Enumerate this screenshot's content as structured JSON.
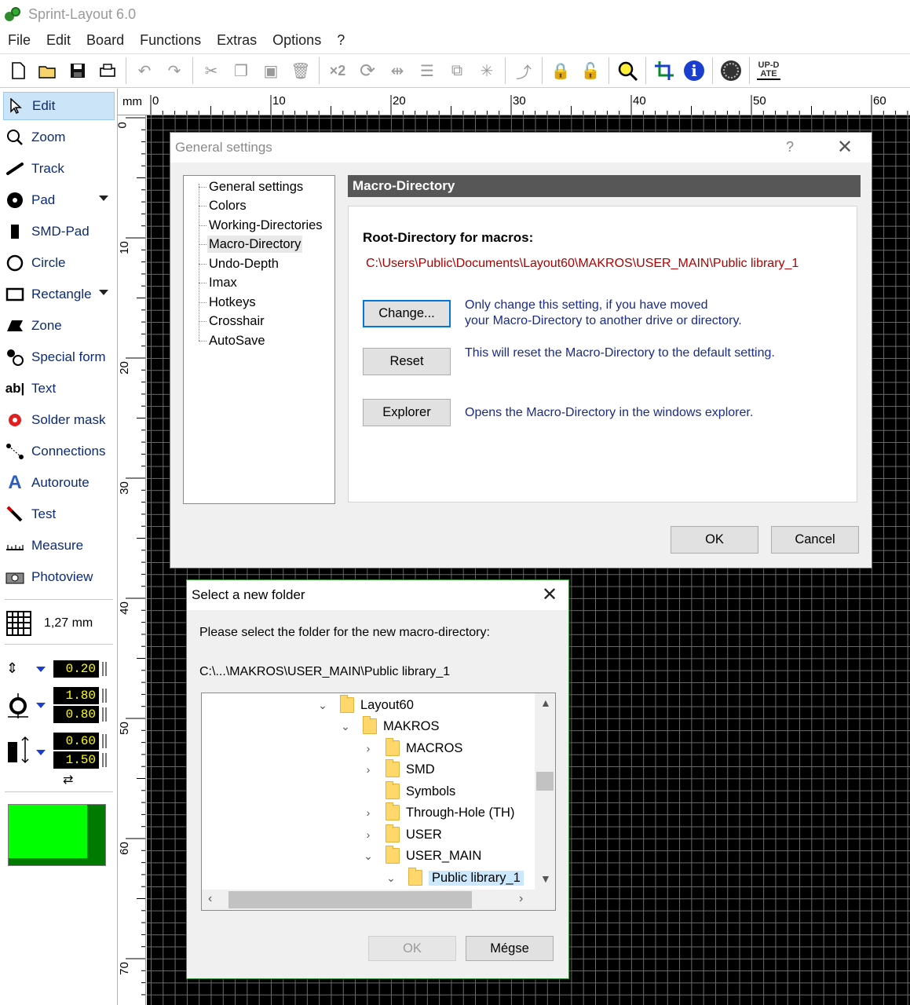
{
  "app": {
    "title": "Sprint-Layout 6.0"
  },
  "menu": [
    "File",
    "Edit",
    "Board",
    "Functions",
    "Extras",
    "Options",
    "?"
  ],
  "toolbar": {
    "buttons": [
      "new-file-icon",
      "open-folder-icon",
      "save-icon",
      "print-icon",
      "undo-icon",
      "redo-icon",
      "cut-icon",
      "copy-icon",
      "paste-icon",
      "delete-icon",
      "duplicate-x2-icon",
      "rotate-icon",
      "mirror-icon",
      "align-icon",
      "group-icon",
      "explode-icon",
      "route-icon",
      "lock-icon",
      "unlock-icon",
      "search-icon",
      "crop-icon",
      "info-icon",
      "gear-icon",
      "update-icon"
    ],
    "x2_label": "×2",
    "update_label": "UP-DATE"
  },
  "tools": [
    {
      "label": "Edit",
      "icon": "pointer-icon"
    },
    {
      "label": "Zoom",
      "icon": "magnifier-icon"
    },
    {
      "label": "Track",
      "icon": "track-icon"
    },
    {
      "label": "Pad",
      "icon": "pad-icon"
    },
    {
      "label": "SMD-Pad",
      "icon": "smd-pad-icon"
    },
    {
      "label": "Circle",
      "icon": "circle-icon"
    },
    {
      "label": "Rectangle",
      "icon": "rectangle-icon"
    },
    {
      "label": "Zone",
      "icon": "zone-icon"
    },
    {
      "label": "Special form",
      "icon": "special-form-icon"
    },
    {
      "label": "Text",
      "icon": "text-icon"
    },
    {
      "label": "Solder mask",
      "icon": "solder-mask-icon"
    },
    {
      "label": "Connections",
      "icon": "connections-icon"
    },
    {
      "label": "Autoroute",
      "icon": "autoroute-icon"
    },
    {
      "label": "Test",
      "icon": "test-icon"
    },
    {
      "label": "Measure",
      "icon": "measure-icon"
    },
    {
      "label": "Photoview",
      "icon": "camera-icon"
    }
  ],
  "tool_misc": {
    "text_icon_glyph": "ab|"
  },
  "grid": {
    "value": "1,27 mm"
  },
  "params": {
    "track_width": "0.20",
    "pad_outer": "1.80",
    "pad_inner": "0.80",
    "smd_width": "0.60",
    "smd_height": "1.50"
  },
  "layer_color": "#00ff00",
  "ruler": {
    "unit": "mm",
    "top_labels": [
      "0",
      "10",
      "20",
      "30",
      "40",
      "50",
      "60"
    ],
    "left_labels": [
      "0",
      "10",
      "20",
      "30",
      "40",
      "50",
      "60",
      "70"
    ]
  },
  "general_settings": {
    "title": "General settings",
    "help": "?",
    "tree": [
      "General settings",
      "Colors",
      "Working-Directories",
      "Macro-Directory",
      "Undo-Depth",
      "Imax",
      "Hotkeys",
      "Crosshair",
      "AutoSave"
    ],
    "selected": "Macro-Directory",
    "header": "Macro-Directory",
    "root_label": "Root-Directory for macros:",
    "root_path": "C:\\Users\\Public\\Documents\\Layout60\\MAKROS\\USER_MAIN\\Public library_1",
    "change_button": "Change...",
    "change_desc_1": "Only change this setting, if you have moved",
    "change_desc_2": "your Macro-Directory to another drive or directory.",
    "reset_button": "Reset",
    "reset_desc": "This will reset the Macro-Directory to the default setting.",
    "explorer_button": "Explorer",
    "explorer_desc": "Opens the Macro-Directory in the windows explorer.",
    "ok": "OK",
    "cancel": "Cancel"
  },
  "folder_dialog": {
    "title": "Select a new folder",
    "prompt": "Please select the folder for the new macro-directory:",
    "current_path": "C:\\...\\MAKROS\\USER_MAIN\\Public library_1",
    "tree": [
      {
        "label": "Layout60",
        "chevron": "expanded"
      },
      {
        "label": "MAKROS",
        "chevron": "expanded"
      },
      {
        "label": "MACROS",
        "chevron": "collapsed"
      },
      {
        "label": "SMD",
        "chevron": "collapsed"
      },
      {
        "label": "Symbols",
        "chevron": "none"
      },
      {
        "label": "Through-Hole (TH)",
        "chevron": "collapsed"
      },
      {
        "label": "USER",
        "chevron": "collapsed"
      },
      {
        "label": "USER_MAIN",
        "chevron": "expanded"
      },
      {
        "label": "Public library_1",
        "chevron": "expanded"
      }
    ],
    "selected": "Public library_1",
    "ok": "OK",
    "cancel": "Mégse"
  }
}
